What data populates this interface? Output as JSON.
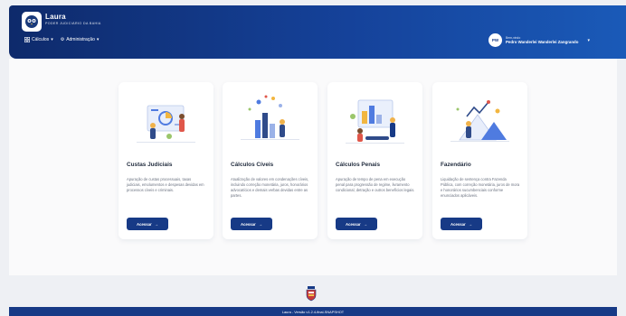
{
  "header": {
    "brand_name": "Laura",
    "brand_subtitle": "PODER JUDICIÁRIO DA BAHIA",
    "menu": [
      {
        "label": "Cálculos",
        "icon": "grid-icon"
      },
      {
        "label": "Administração",
        "icon": "gear-icon"
      }
    ],
    "user": {
      "initials": "PW",
      "greeting": "Bem-vindo",
      "name": "Pedro Wanderlei Wanderlei Zangrando"
    }
  },
  "cards": [
    {
      "title": "Custas Judiciais",
      "description": "Apuração de custas processuais, taxas judiciais, emolumentos e despesas devidas em processos cíveis e criminais.",
      "button": "Acessar"
    },
    {
      "title": "Cálculos Cíveis",
      "description": "Atualização de valores em condenações cíveis, incluindo correção monetária, juros, honorários advocatícios e demais verbas devidas entre as partes.",
      "button": "Acessar"
    },
    {
      "title": "Cálculos Penais",
      "description": "Apuração de tempo de pena em execução penal para progressão de regime, livramento condicional, detração e outros benefícios legais.",
      "button": "Acessar"
    },
    {
      "title": "Fazendário",
      "description": "Liquidação de sentença contra Fazenda Pública, com correção monetária, juros de mora e honorários sucumbenciais conforme enunciados aplicáveis.",
      "button": "Acessar"
    }
  ],
  "footer": {
    "version_text": "Laura - Versão v1.2.4-final-SNAPSHOT"
  },
  "colors": {
    "primary": "#173a86",
    "header_gradient_start": "#0e2a6b",
    "header_gradient_end": "#1a5ab8",
    "page_background": "#eef0f4"
  }
}
